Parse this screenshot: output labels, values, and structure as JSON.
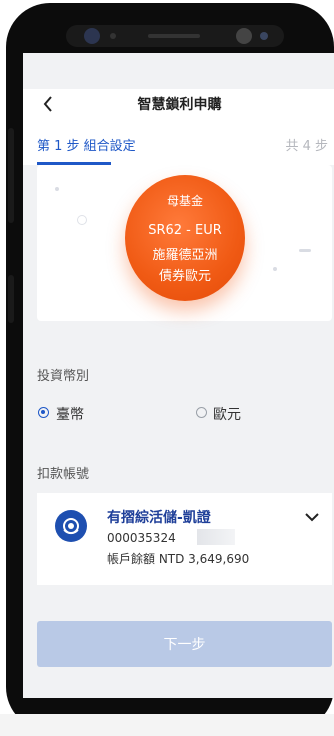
{
  "header": {
    "title": "智慧鎖利申購"
  },
  "steps": {
    "current": "第 1 步  組合設定",
    "total": "共 4 步"
  },
  "fund": {
    "badge": "母基金",
    "code": "SR62 - EUR",
    "name_line1": "施羅德亞洲",
    "name_line2": "債券歐元",
    "color": "#f05a14"
  },
  "currency": {
    "label": "投資幣別",
    "options": [
      {
        "label": "臺幣",
        "selected": true
      },
      {
        "label": "歐元",
        "selected": false
      }
    ]
  },
  "account": {
    "label": "扣款帳號",
    "name": "有摺綜活儲-凱證",
    "number": "000035324",
    "balance": "帳戶餘額 NTD 3,649,690",
    "icon": "bank-coin-icon"
  },
  "footer": {
    "next_label": "下一步"
  },
  "colors": {
    "accent": "#1f58c7",
    "button_disabled": "#b9c9e6"
  }
}
